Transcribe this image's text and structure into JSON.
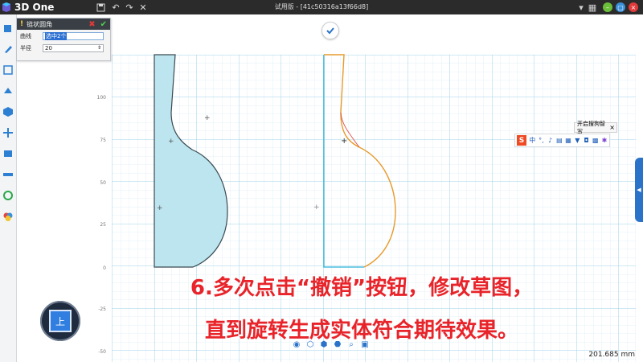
{
  "app": {
    "logo_text": "3D One",
    "window_title": "试用版 - [41c50316a13f66d8]"
  },
  "panel": {
    "title": "链状圆角",
    "curve_label": "曲线",
    "curve_value": "选中2个",
    "radius_label": "半径",
    "radius_value": "20"
  },
  "axis": {
    "labels": [
      "100",
      "75",
      "50",
      "25",
      "0",
      "-25",
      "-50"
    ]
  },
  "viewcube": {
    "label": "上"
  },
  "caption": {
    "line1": "6.多次点击“撤销”按钮，修改草图，",
    "line2": "直到旋转生成实体符合期待效果。"
  },
  "status": {
    "readout": "201.685 mm"
  },
  "ime": {
    "tooltip": "开启搜狗智写",
    "tooltip_close": "×",
    "logo": "S",
    "mode": "中",
    "punct": "°,"
  },
  "colors": {
    "grid_minor": "#dceef7",
    "grid_major": "#9fd3ea",
    "fill": "#bde5ef",
    "outline": "#3a4a52",
    "orange": "#e89a2a",
    "cyan_edge": "#2bb3d9",
    "caption": "#e8242a"
  }
}
